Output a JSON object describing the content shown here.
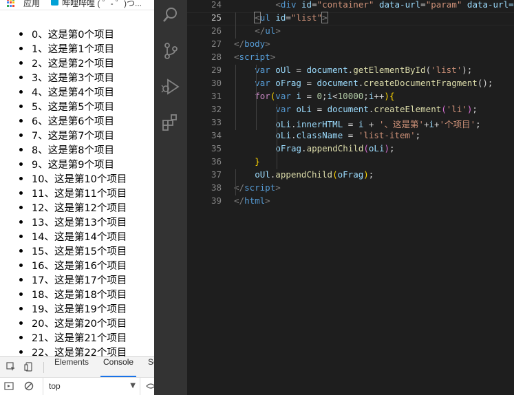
{
  "browser": {
    "bookmarks": {
      "apps_label": "应用",
      "bilibili_label": "哔哩哔哩 ( ゜- ゜)つ..."
    },
    "list_items": [
      "0、这是第0个项目",
      "1、这是第1个项目",
      "2、这是第2个项目",
      "3、这是第3个项目",
      "4、这是第4个项目",
      "5、这是第5个项目",
      "6、这是第6个项目",
      "7、这是第7个项目",
      "8、这是第8个项目",
      "9、这是第9个项目",
      "10、这是第10个项目",
      "11、这是第11个项目",
      "12、这是第12个项目",
      "13、这是第13个项目",
      "14、这是第14个项目",
      "15、这是第15个项目",
      "16、这是第16个项目",
      "17、这是第17个项目",
      "18、这是第18个项目",
      "19、这是第19个项目",
      "20、这是第20个项目",
      "21、这是第21个项目",
      "22、这是第22个项目"
    ],
    "devtools": {
      "tabs": [
        "Elements",
        "Console",
        "Sources"
      ],
      "active_tab": "Console",
      "context_value": "top",
      "icons": [
        "inspect-icon",
        "device-toolbar-icon",
        "sidebar-toggle-icon",
        "clear-console-icon",
        "dropdown-arrow-icon"
      ]
    }
  },
  "editor": {
    "activity_icons": [
      "search-icon",
      "source-control-icon",
      "debug-icon",
      "extensions-icon"
    ],
    "current_line": 25,
    "lines": [
      {
        "n": 24,
        "indent": 2,
        "tokens": [
          [
            "<",
            "brk"
          ],
          [
            "div",
            "tag"
          ],
          [
            " ",
            "plain"
          ],
          [
            "id",
            "attr"
          ],
          [
            "=",
            "plain"
          ],
          [
            "\"container\"",
            "str"
          ],
          [
            " ",
            "plain"
          ],
          [
            "data-url",
            "attr"
          ],
          [
            "=",
            "plain"
          ],
          [
            "\"param\"",
            "str"
          ],
          [
            " data-url=",
            "attr"
          ]
        ]
      },
      {
        "n": 25,
        "indent": 1,
        "tokens": [
          [
            "<",
            "brk"
          ],
          [
            "ul",
            "tag"
          ],
          [
            " ",
            "plain"
          ],
          [
            "id",
            "attr"
          ],
          [
            "=",
            "plain"
          ],
          [
            "\"list\"",
            "str"
          ],
          [
            ">",
            "brk"
          ]
        ]
      },
      {
        "n": 26,
        "indent": 1,
        "tokens": [
          [
            "</",
            "brk"
          ],
          [
            "ul",
            "tag"
          ],
          [
            ">",
            "brk"
          ]
        ]
      },
      {
        "n": 27,
        "indent": 0,
        "tokens": [
          [
            "</",
            "brk"
          ],
          [
            "body",
            "tag"
          ],
          [
            ">",
            "brk"
          ]
        ]
      },
      {
        "n": 28,
        "indent": 0,
        "tokens": [
          [
            "<",
            "brk"
          ],
          [
            "script",
            "tag"
          ],
          [
            ">",
            "brk"
          ]
        ]
      },
      {
        "n": 29,
        "indent": 1,
        "tokens": [
          [
            "var",
            "kw"
          ],
          [
            " ",
            "plain"
          ],
          [
            "oUl",
            "var"
          ],
          [
            " = ",
            "plain"
          ],
          [
            "document",
            "var"
          ],
          [
            ".",
            "plain"
          ],
          [
            "getElementById",
            "fn"
          ],
          [
            "(",
            "plain"
          ],
          [
            "'list'",
            "str"
          ],
          [
            ");",
            "plain"
          ]
        ]
      },
      {
        "n": 30,
        "indent": 1,
        "tokens": [
          [
            "var",
            "kw"
          ],
          [
            " ",
            "plain"
          ],
          [
            "oFrag",
            "var"
          ],
          [
            " = ",
            "plain"
          ],
          [
            "document",
            "var"
          ],
          [
            ".",
            "plain"
          ],
          [
            "createDocumentFragment",
            "fn"
          ],
          [
            "();",
            "plain"
          ]
        ]
      },
      {
        "n": 31,
        "indent": 1,
        "tokens": [
          [
            "for",
            "ctl"
          ],
          [
            "(",
            "paren1"
          ],
          [
            "var",
            "kw"
          ],
          [
            " ",
            "plain"
          ],
          [
            "i",
            "var"
          ],
          [
            " = ",
            "plain"
          ],
          [
            "0",
            "num"
          ],
          [
            ";",
            "plain"
          ],
          [
            "i",
            "var"
          ],
          [
            "<",
            "plain"
          ],
          [
            "10000",
            "num"
          ],
          [
            ";",
            "plain"
          ],
          [
            "i",
            "var"
          ],
          [
            "++",
            "plain"
          ],
          [
            ")",
            "paren1"
          ],
          [
            "{",
            "paren1"
          ]
        ]
      },
      {
        "n": 32,
        "indent": 2,
        "tokens": [
          [
            "var",
            "kw"
          ],
          [
            " ",
            "plain"
          ],
          [
            "oLi",
            "var"
          ],
          [
            " = ",
            "plain"
          ],
          [
            "document",
            "var"
          ],
          [
            ".",
            "plain"
          ],
          [
            "createElement",
            "fn"
          ],
          [
            "(",
            "paren2"
          ],
          [
            "'li'",
            "str"
          ],
          [
            ")",
            "paren2"
          ],
          [
            ";",
            "plain"
          ]
        ]
      },
      {
        "n": 33,
        "indent": 2,
        "tokens": [
          [
            "oLi",
            "var"
          ],
          [
            ".",
            "plain"
          ],
          [
            "innerHTML",
            "var"
          ],
          [
            " = ",
            "plain"
          ],
          [
            "i",
            "var"
          ],
          [
            " + ",
            "plain"
          ],
          [
            "'、这是第'",
            "str"
          ],
          [
            "+",
            "plain"
          ],
          [
            "i",
            "var"
          ],
          [
            "+",
            "plain"
          ],
          [
            "'个项目'",
            "str"
          ],
          [
            ";",
            "plain"
          ]
        ]
      },
      {
        "n": 34,
        "indent": 2,
        "tokens": [
          [
            "oLi",
            "var"
          ],
          [
            ".",
            "plain"
          ],
          [
            "className",
            "var"
          ],
          [
            " = ",
            "plain"
          ],
          [
            "'list-item'",
            "str"
          ],
          [
            ";",
            "plain"
          ]
        ]
      },
      {
        "n": 35,
        "indent": 2,
        "tokens": [
          [
            "oFrag",
            "var"
          ],
          [
            ".",
            "plain"
          ],
          [
            "appendChild",
            "fn"
          ],
          [
            "(",
            "paren2"
          ],
          [
            "oLi",
            "var"
          ],
          [
            ")",
            "paren2"
          ],
          [
            ";",
            "plain"
          ]
        ]
      },
      {
        "n": 36,
        "indent": 1,
        "tokens": [
          [
            "}",
            "paren1"
          ]
        ]
      },
      {
        "n": 37,
        "indent": 1,
        "tokens": [
          [
            "oUl",
            "var"
          ],
          [
            ".",
            "plain"
          ],
          [
            "appendChild",
            "fn"
          ],
          [
            "(",
            "paren1"
          ],
          [
            "oFrag",
            "var"
          ],
          [
            ")",
            "paren1"
          ],
          [
            ";",
            "plain"
          ]
        ]
      },
      {
        "n": 38,
        "indent": 0,
        "tokens": [
          [
            "</",
            "brk"
          ],
          [
            "script",
            "tag"
          ],
          [
            ">",
            "brk"
          ]
        ]
      },
      {
        "n": 39,
        "indent": 0,
        "tokens": [
          [
            "</",
            "brk"
          ],
          [
            "html",
            "tag"
          ],
          [
            ">",
            "brk"
          ]
        ]
      }
    ]
  },
  "colors": {
    "activity_bar": "#333333",
    "editor_bg": "#1e1e1e",
    "accent": "#1a73e8"
  }
}
